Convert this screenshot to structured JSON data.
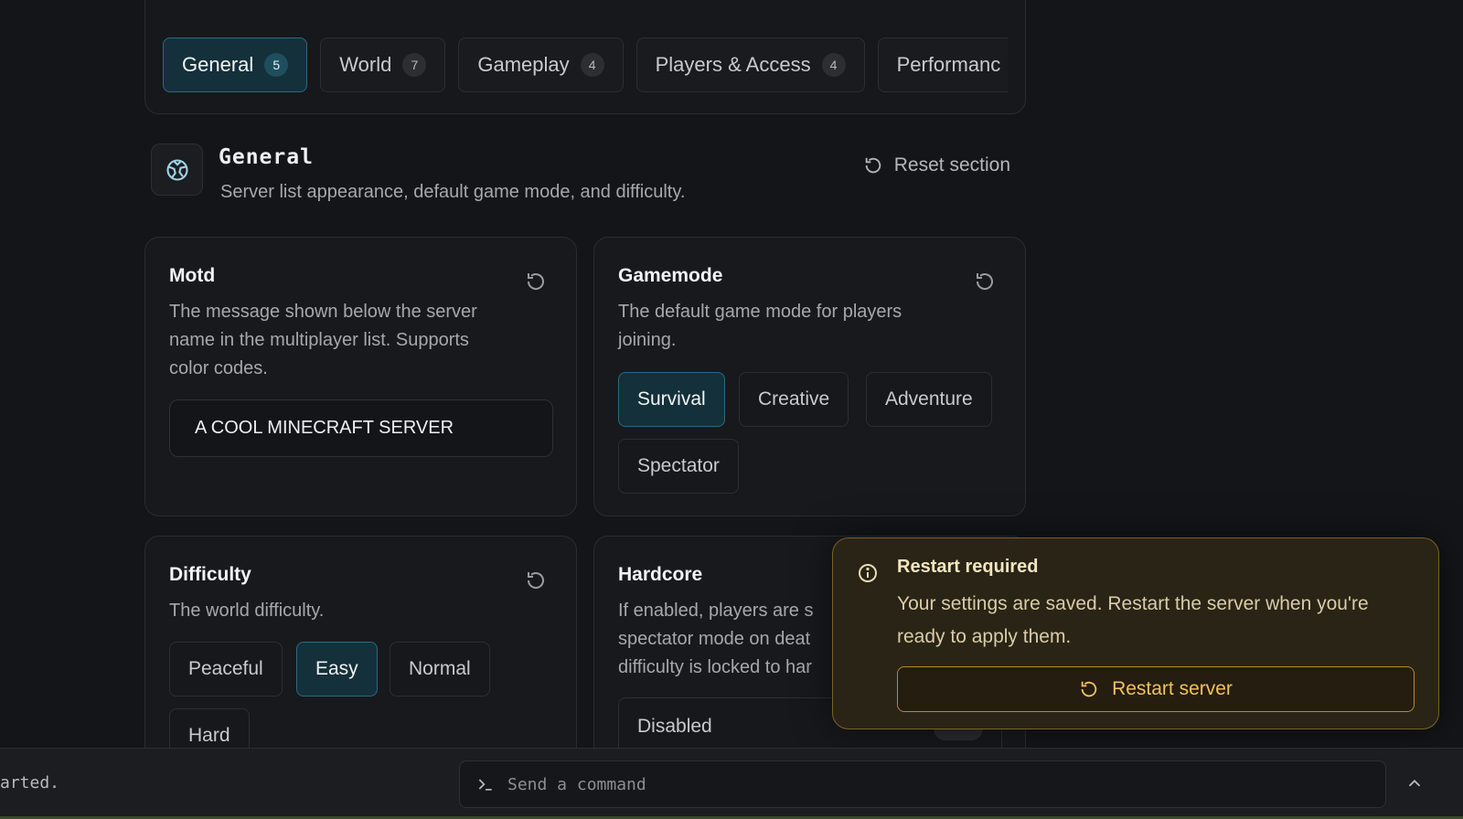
{
  "tabs": [
    {
      "label": "General",
      "count": "5"
    },
    {
      "label": "World",
      "count": "7"
    },
    {
      "label": "Gameplay",
      "count": "4"
    },
    {
      "label": "Players & Access",
      "count": "4"
    },
    {
      "label": "Performanc",
      "count": ""
    }
  ],
  "section": {
    "title": "General",
    "description": "Server list appearance, default game mode, and difficulty.",
    "reset_label": "Reset section"
  },
  "motd": {
    "title": "Motd",
    "description": "The message shown below the server name in the multiplayer list. Supports color codes.",
    "value": "A COOL MINECRAFT SERVER"
  },
  "gamemode": {
    "title": "Gamemode",
    "description": "The default game mode for players joining.",
    "options": [
      "Survival",
      "Creative",
      "Adventure",
      "Spectator"
    ],
    "selected": "Survival"
  },
  "difficulty": {
    "title": "Difficulty",
    "description": "The world difficulty.",
    "options": [
      "Peaceful",
      "Easy",
      "Normal",
      "Hard"
    ],
    "selected": "Easy"
  },
  "hardcore": {
    "title": "Hardcore",
    "description": "If enabled, players are s spectator mode on deat difficulty is locked to har",
    "line1": "If enabled, players are s",
    "line2": "spectator mode on deat",
    "line3": "difficulty is locked to har",
    "value": "Disabled"
  },
  "toast": {
    "title": "Restart required",
    "body": "Your settings are saved. Restart the server when you're ready to apply them.",
    "button": "Restart server"
  },
  "console": {
    "log_tail": "arted.",
    "placeholder": "Send a command"
  },
  "colors": {
    "accent": "#2b6a80",
    "warning": "#f2c25a",
    "background": "#141518"
  }
}
